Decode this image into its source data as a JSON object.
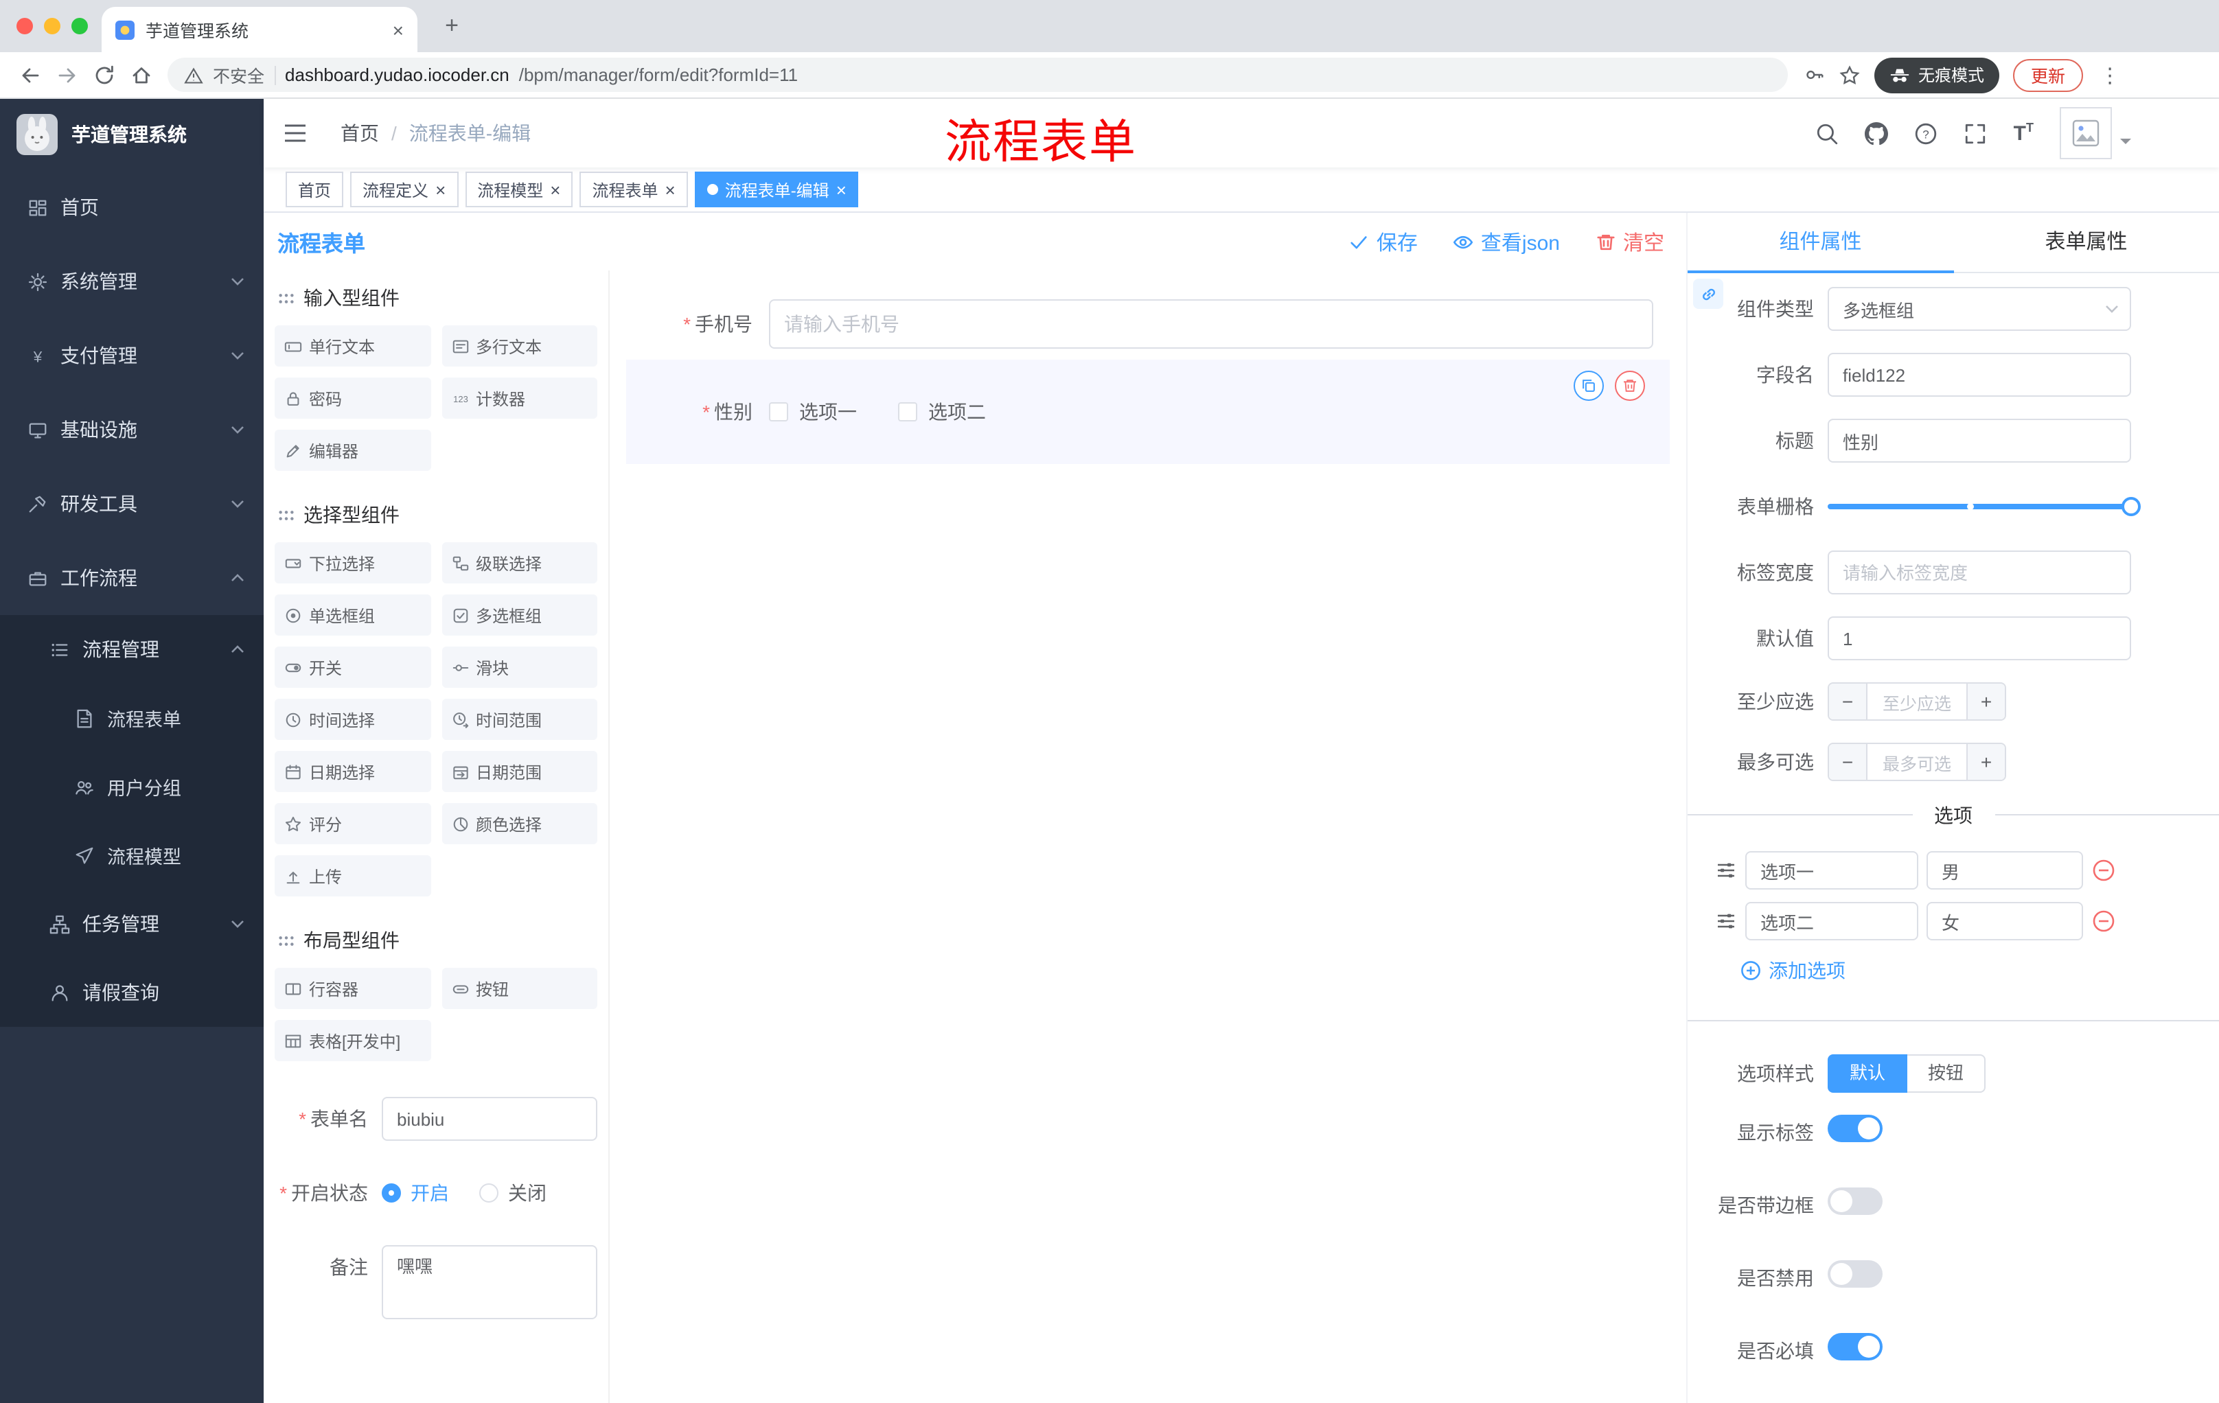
{
  "glyphs": {
    "close": "×",
    "plus": "+",
    "minus": "−",
    "kebab": "⋮",
    "separator": "/",
    "required": "*"
  },
  "icons": {
    "yen": "¥",
    "question": "?",
    "counter": "123",
    "font_big": "T",
    "font_small": "T"
  },
  "colors": {
    "primary": "#409eff",
    "danger": "#f56c6c"
  },
  "browser": {
    "tab_title": "芋道管理系统",
    "security_label": "不安全",
    "url_domain": "dashboard.yudao.iocoder.cn",
    "url_path": "/bpm/manager/form/edit?formId=11",
    "incognito_label": "无痕模式",
    "update_label": "更新"
  },
  "sidebar": {
    "logo_title": "芋道管理系统",
    "menu": [
      {
        "label": "首页"
      },
      {
        "label": "系统管理"
      },
      {
        "label": "支付管理"
      },
      {
        "label": "基础设施"
      },
      {
        "label": "研发工具"
      },
      {
        "label": "工作流程"
      },
      {
        "label": "流程管理"
      },
      {
        "label": "流程表单"
      },
      {
        "label": "用户分组"
      },
      {
        "label": "流程模型"
      },
      {
        "label": "任务管理"
      },
      {
        "label": "请假查询"
      }
    ]
  },
  "navbar": {
    "breadcrumb_home": "首页",
    "breadcrumb_current": "流程表单-编辑",
    "annotation": "流程表单"
  },
  "tags": [
    {
      "label": "首页"
    },
    {
      "label": "流程定义"
    },
    {
      "label": "流程模型"
    },
    {
      "label": "流程表单"
    },
    {
      "label": "流程表单-编辑"
    }
  ],
  "designer": {
    "title": "流程表单",
    "save": "保存",
    "view_json": "查看json",
    "clear": "清空"
  },
  "palette": {
    "sections": [
      {
        "title": "输入型组件",
        "items": [
          "单行文本",
          "多行文本",
          "密码",
          "计数器",
          "编辑器"
        ]
      },
      {
        "title": "选择型组件",
        "items": [
          "下拉选择",
          "级联选择",
          "单选框组",
          "多选框组",
          "开关",
          "滑块",
          "时间选择",
          "时间范围",
          "日期选择",
          "日期范围",
          "评分",
          "颜色选择",
          "上传"
        ]
      },
      {
        "title": "布局型组件",
        "items": [
          "行容器",
          "按钮",
          "表格[开发中]"
        ]
      }
    ]
  },
  "page_form": {
    "name_label": "表单名",
    "name_value": "biubiu",
    "status_label": "开启状态",
    "status_on": "开启",
    "status_off": "关闭",
    "remark_label": "备注",
    "remark_value": "嘿嘿"
  },
  "canvas": {
    "phone_label": "手机号",
    "phone_placeholder": "请输入手机号",
    "gender_label": "性别",
    "gender_opt1": "选项一",
    "gender_opt2": "选项二"
  },
  "props": {
    "tab_component": "组件属性",
    "tab_form": "表单属性",
    "component_type_label": "组件类型",
    "component_type_value": "多选框组",
    "field_label": "字段名",
    "field_value": "field122",
    "title_label": "标题",
    "title_value": "性别",
    "grid_label": "表单栅格",
    "label_width_label": "标签宽度",
    "label_width_placeholder": "请输入标签宽度",
    "default_label": "默认值",
    "default_value": "1",
    "min_label": "至少应选",
    "min_placeholder": "至少应选",
    "max_label": "最多可选",
    "max_placeholder": "最多可选",
    "options_title": "选项",
    "options": [
      {
        "label": "选项一",
        "value": "男"
      },
      {
        "label": "选项二",
        "value": "女"
      }
    ],
    "add_option": "添加选项",
    "style_label": "选项样式",
    "style_default": "默认",
    "style_button": "按钮",
    "toggle_show_label": "显示标签",
    "toggle_border": "是否带边框",
    "toggle_disabled": "是否禁用",
    "toggle_required": "是否必填"
  }
}
